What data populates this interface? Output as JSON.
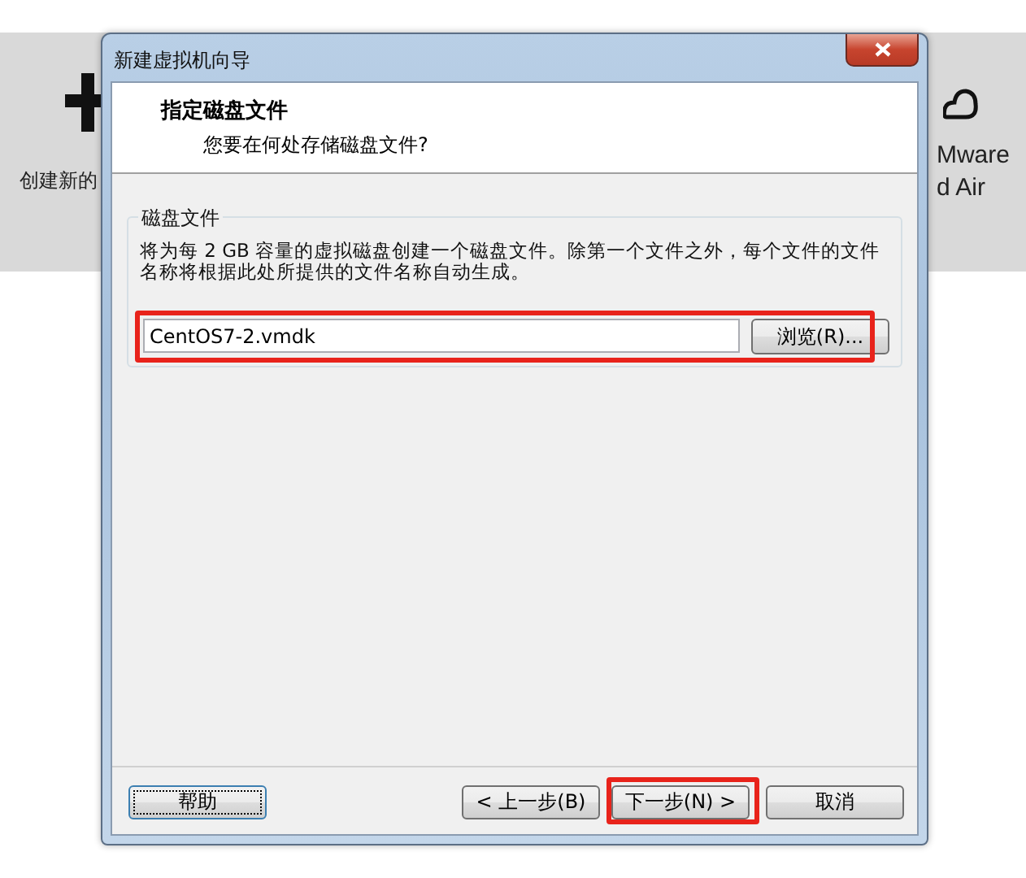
{
  "background": {
    "left_tile": {
      "label": "创建新的"
    },
    "right_tile": {
      "lines": [
        "Mware",
        "d Air"
      ]
    }
  },
  "window": {
    "title": "新建虚拟机向导"
  },
  "header": {
    "title": "指定磁盘文件",
    "subtitle": "您要在何处存储磁盘文件?"
  },
  "group": {
    "title": "磁盘文件",
    "description": "将为每 2 GB 容量的虚拟磁盘创建一个磁盘文件。除第一个文件之外，每个文件的文件名称将根据此处所提供的文件名称自动生成。",
    "field": {
      "value": "CentOS7-2.vmdk"
    },
    "browse_button": {
      "label": "浏览(R)..."
    },
    "highlighted": true
  },
  "buttons": [
    {
      "label": "帮助",
      "focused": true,
      "highlighted": false
    },
    {
      "label": "< 上一步(B)",
      "focused": false,
      "highlighted": false
    },
    {
      "label": "下一步(N) >",
      "focused": false,
      "highlighted": true
    },
    {
      "label": "取消",
      "focused": false,
      "highlighted": false
    }
  ]
}
